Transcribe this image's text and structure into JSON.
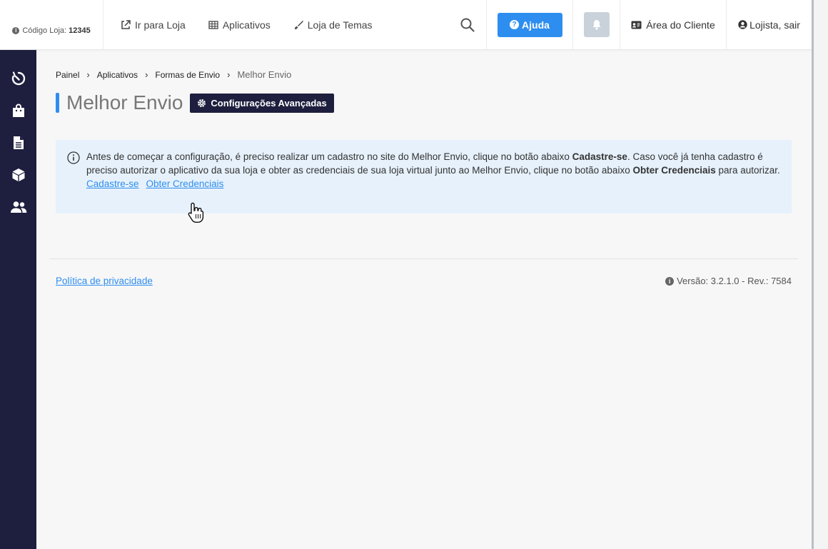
{
  "topbar": {
    "store_code_label": "Código Loja:",
    "store_code_value": "12345",
    "nav": [
      {
        "label": "Ir para Loja",
        "icon": "external-link-icon"
      },
      {
        "label": "Aplicativos",
        "icon": "grid-icon"
      },
      {
        "label": "Loja de Temas",
        "icon": "brush-icon"
      }
    ],
    "help_label": "Ajuda",
    "client_area_label": "Área do Cliente",
    "logout_label": "Lojista, sair"
  },
  "sidebar": {
    "items": [
      "dashboard-icon",
      "shopping-bag-icon",
      "document-icon",
      "box-icon",
      "users-icon"
    ]
  },
  "breadcrumb": {
    "items": [
      "Painel",
      "Aplicativos",
      "Formas de Envio"
    ],
    "current": "Melhor Envio"
  },
  "page": {
    "title": "Melhor Envio",
    "advanced_button": "Configurações Avançadas"
  },
  "alert": {
    "text_1": "Antes de começar a configuração, é preciso realizar um cadastro no site do Melhor Envio, clique no botão abaixo ",
    "bold_1": "Cadastre-se",
    "text_2": ". Caso você já tenha cadastro é preciso autorizar o aplicativo da sua loja e obter as credenciais de sua loja virtual junto ao Melhor Envio, clique no botão abaixo ",
    "bold_2": "Obter Credenciais",
    "text_3": " para autorizar.",
    "link_signup": "Cadastre-se",
    "link_credentials": "Obter Credenciais"
  },
  "footer": {
    "privacy": "Política de privacidade",
    "version": "Versão: 3.2.1.0 - Rev.: 7584"
  },
  "colors": {
    "accent": "#2d8ef0",
    "sidebar": "#1e1e3f",
    "alert_bg": "#e6f1fb"
  }
}
